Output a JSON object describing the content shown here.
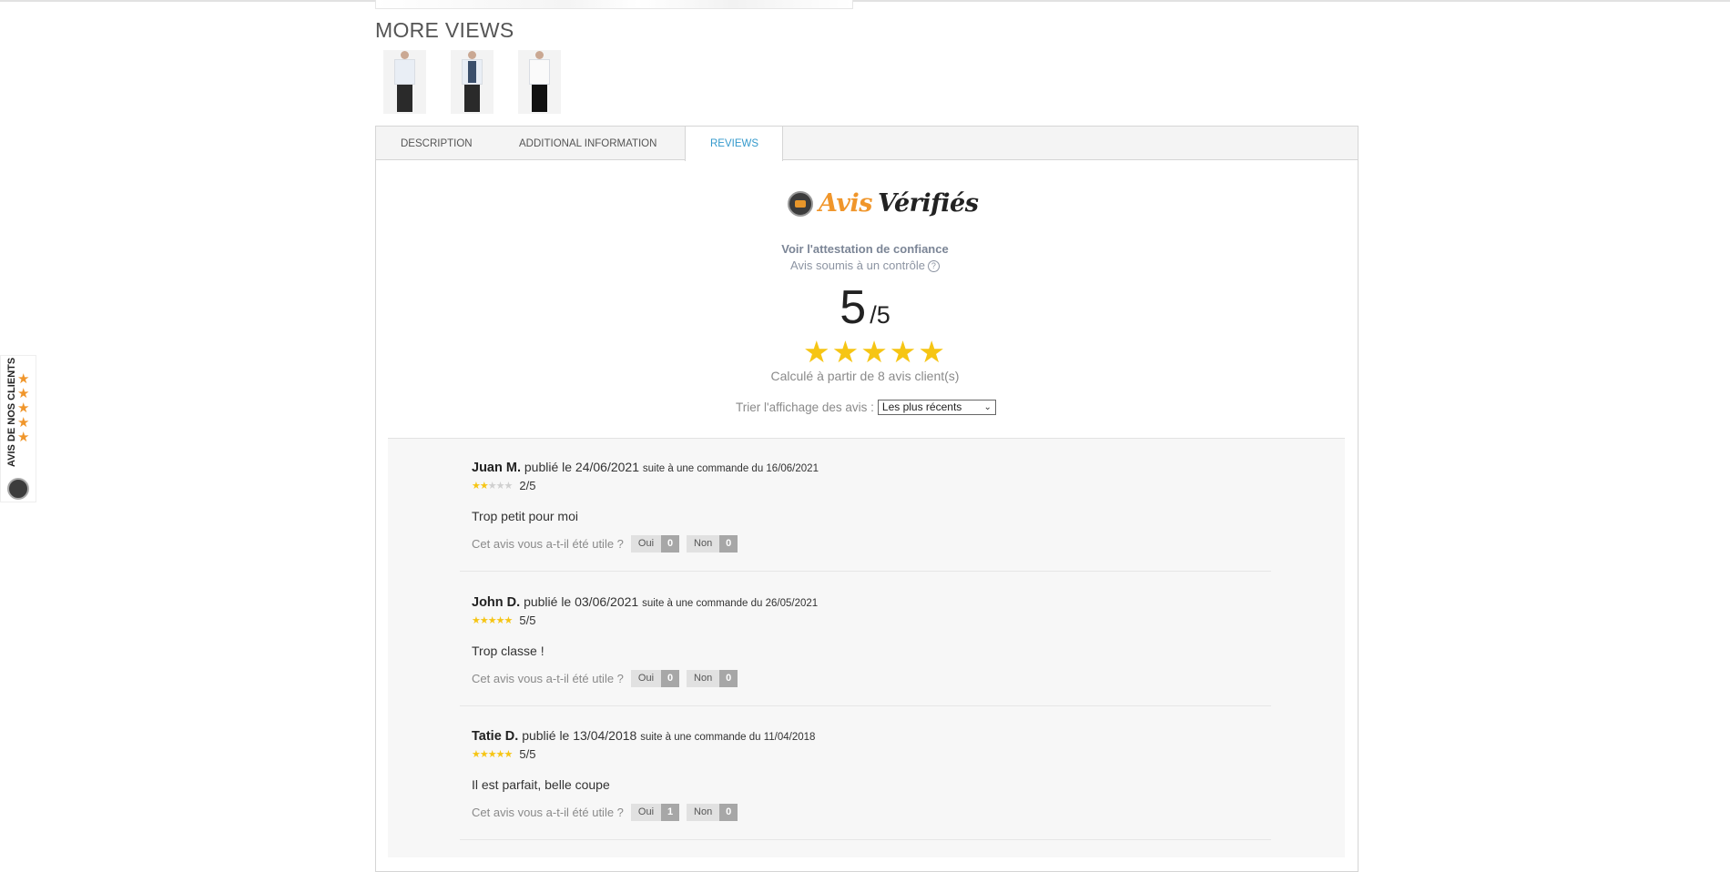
{
  "more_views": {
    "title": "MORE VIEWS",
    "thumbnails": [
      "product-view-front",
      "product-view-open",
      "product-view-white"
    ]
  },
  "tabs": [
    {
      "label": "DESCRIPTION",
      "active": false
    },
    {
      "label": "ADDITIONAL INFORMATION",
      "active": false
    },
    {
      "label": "REVIEWS",
      "active": true
    }
  ],
  "reviews_widget": {
    "brand_part1": "Avis",
    "brand_part2": "Vérifiés",
    "attestation": "Voir l'attestation de confiance",
    "controlled": "Avis soumis à un contrôle",
    "score": "5",
    "score_max": "/5",
    "computed_from": "Calculé à partir de 8 avis client(s)",
    "sort_label": "Trier l'affichage des avis :",
    "sort_value": "Les plus récents",
    "accent_color": "#f6c514"
  },
  "reviews": [
    {
      "name": "Juan M.",
      "published": "publié le 24/06/2021",
      "order": "suite à une commande du 16/06/2021",
      "stars": 2,
      "rating": "2/5",
      "text": "Trop petit pour moi",
      "useful_q": "Cet avis vous a-t-il été utile ?",
      "yes_label": "Oui",
      "yes_count": "0",
      "no_label": "Non",
      "no_count": "0"
    },
    {
      "name": "John D.",
      "published": "publié le 03/06/2021",
      "order": "suite à une commande du 26/05/2021",
      "stars": 5,
      "rating": "5/5",
      "text": "Trop classe !",
      "useful_q": "Cet avis vous a-t-il été utile ?",
      "yes_label": "Oui",
      "yes_count": "0",
      "no_label": "Non",
      "no_count": "0"
    },
    {
      "name": "Tatie D.",
      "published": "publié le 13/04/2018",
      "order": "suite à une commande du 11/04/2018",
      "stars": 5,
      "rating": "5/5",
      "text": "Il est parfait, belle coupe",
      "useful_q": "Cet avis vous a-t-il été utile ?",
      "yes_label": "Oui",
      "yes_count": "1",
      "no_label": "Non",
      "no_count": "0"
    }
  ],
  "side_widget": {
    "label": "AVIS DE NOS CLIENTS",
    "star_color": "#f0962b"
  }
}
